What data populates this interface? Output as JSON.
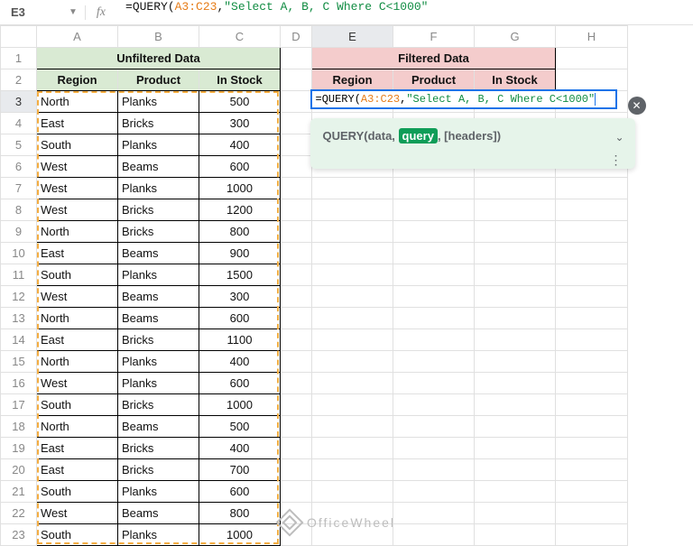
{
  "formula_bar": {
    "cell_ref": "E3",
    "prefix": "=QUERY(",
    "range": "A3:C23",
    "sep": ",",
    "query_str": "\"Select A, B, C Where C<1000\""
  },
  "columns": [
    "A",
    "B",
    "C",
    "D",
    "E",
    "F",
    "G",
    "H"
  ],
  "rows_count": 23,
  "selected_col": "E",
  "selected_row": 3,
  "titles": {
    "unfiltered": "Unfiltered Data",
    "filtered": "Filtered Data"
  },
  "headers": {
    "region": "Region",
    "product": "Product",
    "in_stock": "In Stock"
  },
  "unfiltered_data": [
    {
      "region": "North",
      "product": "Planks",
      "stock": 500
    },
    {
      "region": "East",
      "product": "Bricks",
      "stock": 300
    },
    {
      "region": "South",
      "product": "Planks",
      "stock": 400
    },
    {
      "region": "West",
      "product": "Beams",
      "stock": 600
    },
    {
      "region": "West",
      "product": "Planks",
      "stock": 1000
    },
    {
      "region": "West",
      "product": "Bricks",
      "stock": 1200
    },
    {
      "region": "North",
      "product": "Bricks",
      "stock": 800
    },
    {
      "region": "East",
      "product": "Beams",
      "stock": 900
    },
    {
      "region": "South",
      "product": "Planks",
      "stock": 1500
    },
    {
      "region": "West",
      "product": "Beams",
      "stock": 300
    },
    {
      "region": "North",
      "product": "Beams",
      "stock": 600
    },
    {
      "region": "East",
      "product": "Bricks",
      "stock": 1100
    },
    {
      "region": "North",
      "product": "Planks",
      "stock": 400
    },
    {
      "region": "West",
      "product": "Planks",
      "stock": 600
    },
    {
      "region": "South",
      "product": "Bricks",
      "stock": 1000
    },
    {
      "region": "North",
      "product": "Beams",
      "stock": 500
    },
    {
      "region": "East",
      "product": "Bricks",
      "stock": 400
    },
    {
      "region": "East",
      "product": "Bricks",
      "stock": 700
    },
    {
      "region": "South",
      "product": "Planks",
      "stock": 600
    },
    {
      "region": "West",
      "product": "Beams",
      "stock": 800
    },
    {
      "region": "South",
      "product": "Planks",
      "stock": 1000
    }
  ],
  "active_cell_formula": {
    "prefix": "=QUERY(",
    "range": "A3:C23",
    "sep": ",",
    "query_str": "\"Select A, B, C Where C<1000\"",
    "cursor_after": true
  },
  "helper": {
    "fn": "QUERY",
    "sig_prefix": "(data, ",
    "sig_highlight": "query",
    "sig_suffix": ", [headers])"
  },
  "watermark": "OfficeWheel",
  "chart_data": {
    "type": "table",
    "title": "Unfiltered Data",
    "columns": [
      "Region",
      "Product",
      "In Stock"
    ],
    "rows": [
      [
        "North",
        "Planks",
        500
      ],
      [
        "East",
        "Bricks",
        300
      ],
      [
        "South",
        "Planks",
        400
      ],
      [
        "West",
        "Beams",
        600
      ],
      [
        "West",
        "Planks",
        1000
      ],
      [
        "West",
        "Bricks",
        1200
      ],
      [
        "North",
        "Bricks",
        800
      ],
      [
        "East",
        "Beams",
        900
      ],
      [
        "South",
        "Planks",
        1500
      ],
      [
        "West",
        "Beams",
        300
      ],
      [
        "North",
        "Beams",
        600
      ],
      [
        "East",
        "Bricks",
        1100
      ],
      [
        "North",
        "Planks",
        400
      ],
      [
        "West",
        "Planks",
        600
      ],
      [
        "South",
        "Bricks",
        1000
      ],
      [
        "North",
        "Beams",
        500
      ],
      [
        "East",
        "Bricks",
        400
      ],
      [
        "East",
        "Bricks",
        700
      ],
      [
        "South",
        "Planks",
        600
      ],
      [
        "West",
        "Beams",
        800
      ],
      [
        "South",
        "Planks",
        1000
      ]
    ]
  }
}
